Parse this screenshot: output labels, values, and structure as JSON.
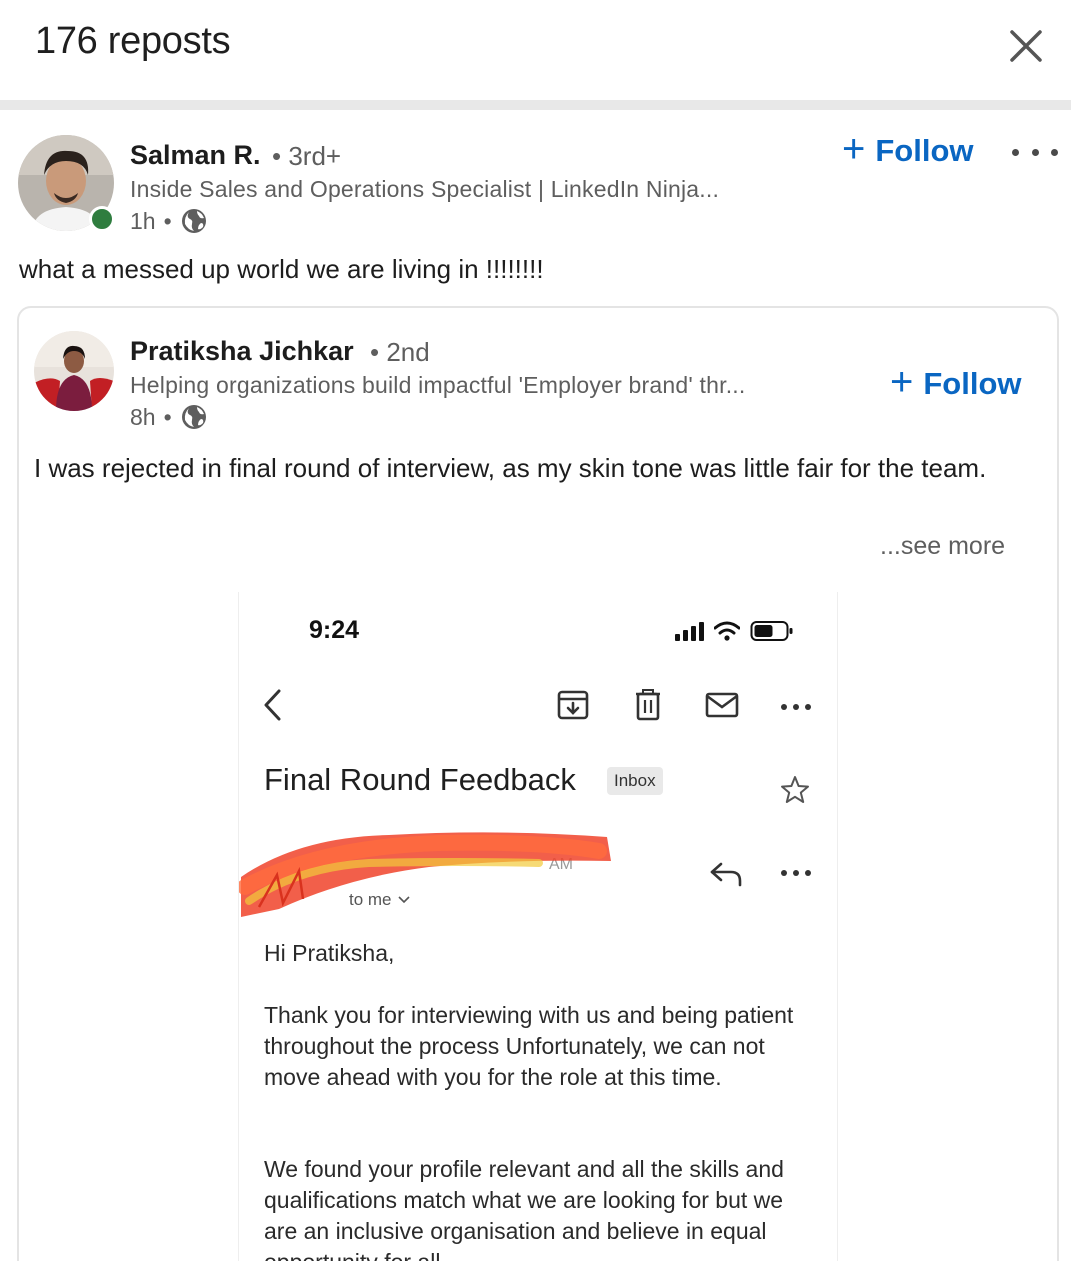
{
  "modal": {
    "title": "176 reposts"
  },
  "reposter": {
    "name": "Salman R.",
    "degree": "3rd+",
    "headline": "Inside Sales and Operations Specialist | LinkedIn Ninja...",
    "time": "1h",
    "follow_label": "Follow",
    "online": true,
    "commentary": "what a messed up world we are living in !!!!!!!!"
  },
  "original_post": {
    "name": "Pratiksha Jichkar",
    "degree": "2nd",
    "headline": "Helping organizations build impactful 'Employer brand' thr...",
    "time": "8h",
    "follow_label": "Follow",
    "text": "I was rejected in final round of interview, as my skin tone was little fair for the team.",
    "see_more": "...see more"
  },
  "email_screenshot": {
    "time": "9:24",
    "subject": "Final Round Feedback",
    "label": "Inbox",
    "recipient": "to me",
    "sender_time_fragment": "AM",
    "greeting": "Hi Pratiksha,",
    "paragraph1": "Thank you for interviewing with us and being patient throughout the process Unfortunately, we can not move ahead with you for the role at this time.",
    "paragraph2": "We found your profile relevant and all the skills and qualifications match what we are looking for but we are an inclusive organisation and believe in equal opportunity for all."
  },
  "colors": {
    "brand_blue": "#0a66c2",
    "online_green": "#2f7d3f",
    "scribble_red": "#f0432a"
  }
}
